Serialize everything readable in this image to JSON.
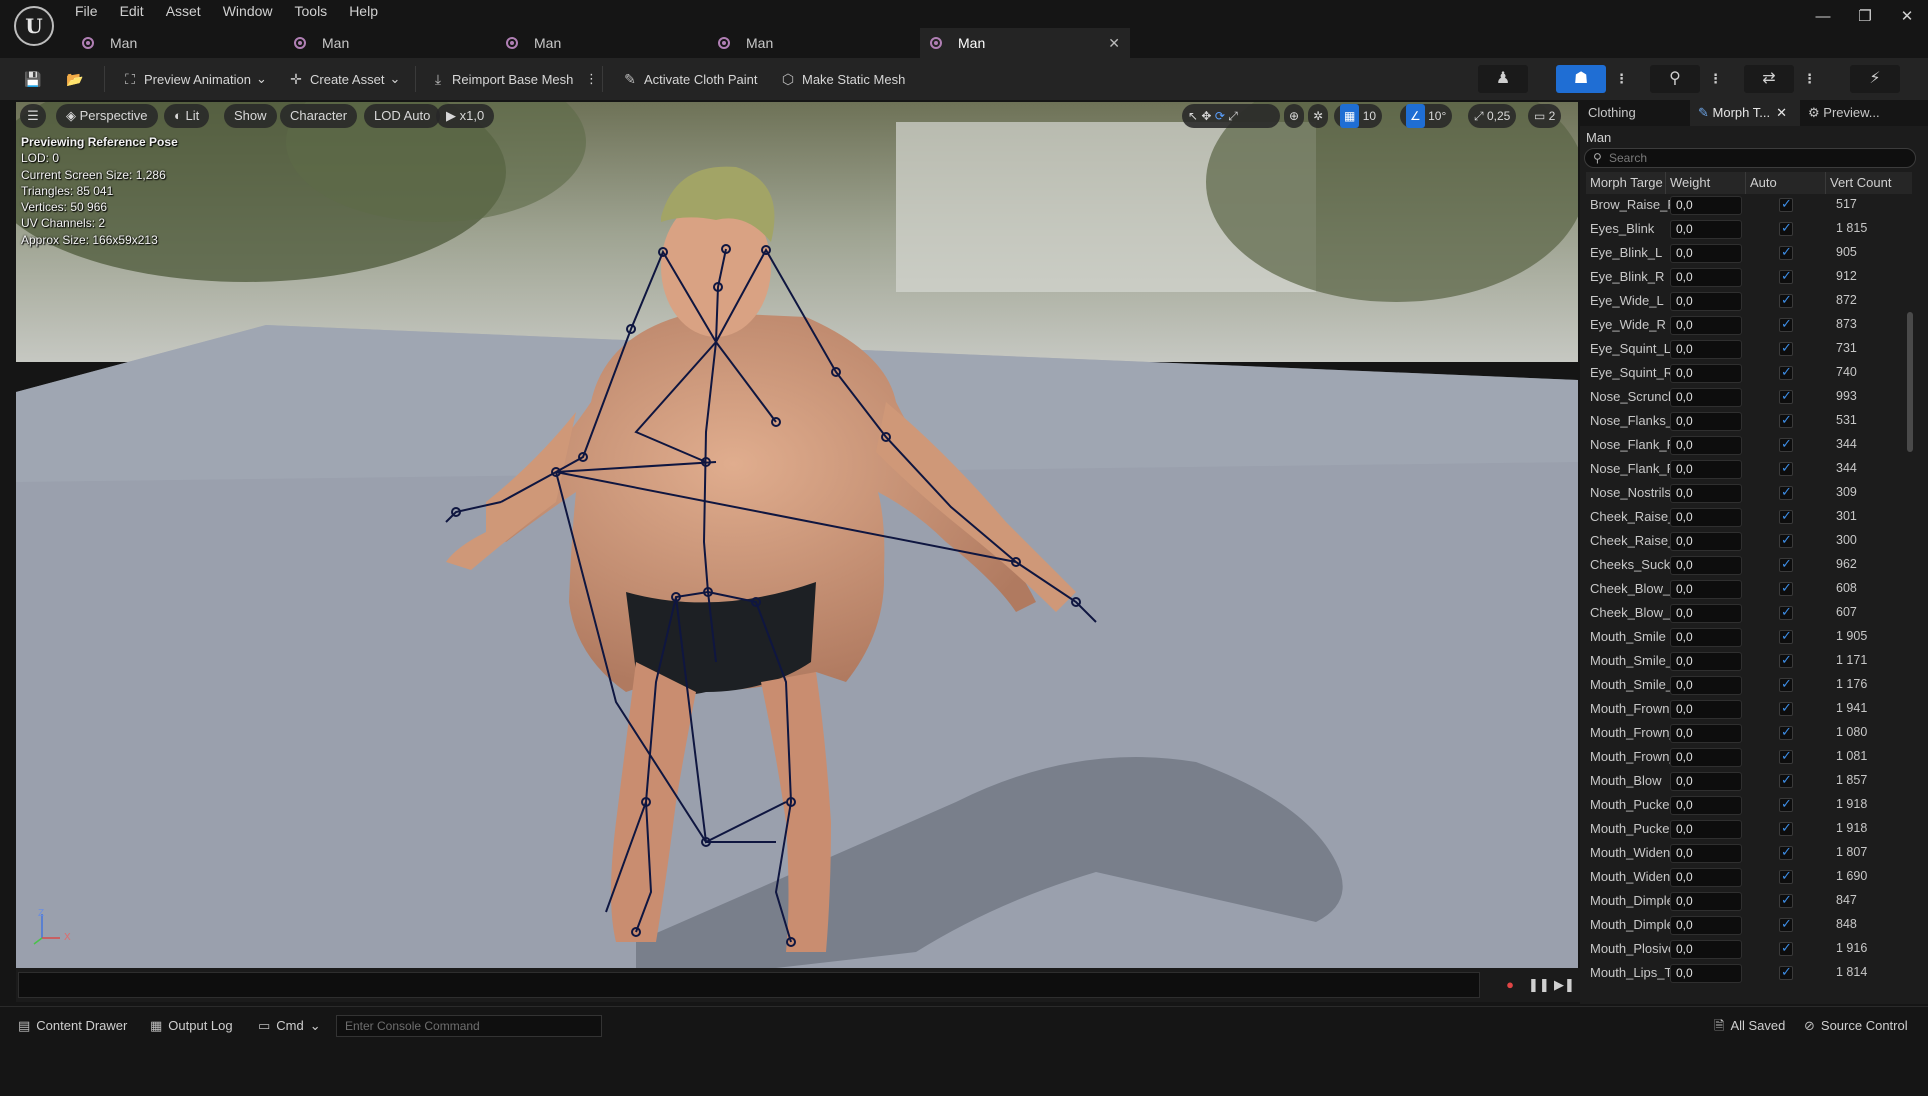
{
  "menu": [
    "File",
    "Edit",
    "Asset",
    "Window",
    "Tools",
    "Help"
  ],
  "doc_tabs": [
    {
      "label": "Man"
    },
    {
      "label": "Man"
    },
    {
      "label": "Man"
    },
    {
      "label": "Man"
    },
    {
      "label": "Man",
      "active": true
    }
  ],
  "window_controls": {
    "minimize": "—",
    "restore": "❐",
    "close": "✕"
  },
  "toolbar": {
    "preview_animation": "Preview Animation",
    "create_asset": "Create Asset",
    "reimport": "Reimport Base Mesh",
    "activate_cloth": "Activate Cloth Paint",
    "make_static": "Make Static Mesh"
  },
  "viewport": {
    "perspective": "Perspective",
    "lit": "Lit",
    "show": "Show",
    "character": "Character",
    "lod": "LOD Auto",
    "speed": "x1,0",
    "grid_snap": "10",
    "rot_snap": "10°",
    "scale_snap": "0,25",
    "camera_speed": "2",
    "info": [
      "Previewing Reference Pose",
      "LOD: 0",
      "Current Screen Size: 1,286",
      "Triangles: 85 041",
      "Vertices: 50 966",
      "UV Channels: 2",
      "Approx Size: 166x59x213"
    ],
    "axis_z": "Z",
    "axis_x": "X"
  },
  "right_panel": {
    "tabs": [
      "Clothing",
      "Morph T...",
      "Preview..."
    ],
    "title": "Man",
    "search_placeholder": "Search",
    "headers": [
      "Morph Targe",
      "Weight",
      "Auto",
      "Vert Count"
    ],
    "rows": [
      {
        "name": "Brow_Raise_F",
        "weight": "0,0",
        "verts": "517"
      },
      {
        "name": "Eyes_Blink",
        "weight": "0,0",
        "verts": "1 815"
      },
      {
        "name": "Eye_Blink_L",
        "weight": "0,0",
        "verts": "905"
      },
      {
        "name": "Eye_Blink_R",
        "weight": "0,0",
        "verts": "912"
      },
      {
        "name": "Eye_Wide_L",
        "weight": "0,0",
        "verts": "872"
      },
      {
        "name": "Eye_Wide_R",
        "weight": "0,0",
        "verts": "873"
      },
      {
        "name": "Eye_Squint_L",
        "weight": "0,0",
        "verts": "731"
      },
      {
        "name": "Eye_Squint_R",
        "weight": "0,0",
        "verts": "740"
      },
      {
        "name": "Nose_Scruncl",
        "weight": "0,0",
        "verts": "993"
      },
      {
        "name": "Nose_Flanks_",
        "weight": "0,0",
        "verts": "531"
      },
      {
        "name": "Nose_Flank_R",
        "weight": "0,0",
        "verts": "344"
      },
      {
        "name": "Nose_Flank_R",
        "weight": "0,0",
        "verts": "344"
      },
      {
        "name": "Nose_Nostrils",
        "weight": "0,0",
        "verts": "309"
      },
      {
        "name": "Cheek_Raise_",
        "weight": "0,0",
        "verts": "301"
      },
      {
        "name": "Cheek_Raise_",
        "weight": "0,0",
        "verts": "300"
      },
      {
        "name": "Cheeks_Suck",
        "weight": "0,0",
        "verts": "962"
      },
      {
        "name": "Cheek_Blow_L",
        "weight": "0,0",
        "verts": "608"
      },
      {
        "name": "Cheek_Blow_F",
        "weight": "0,0",
        "verts": "607"
      },
      {
        "name": "Mouth_Smile",
        "weight": "0,0",
        "verts": "1 905"
      },
      {
        "name": "Mouth_Smile_",
        "weight": "0,0",
        "verts": "1 171"
      },
      {
        "name": "Mouth_Smile_",
        "weight": "0,0",
        "verts": "1 176"
      },
      {
        "name": "Mouth_Frown",
        "weight": "0,0",
        "verts": "1 941"
      },
      {
        "name": "Mouth_Frown_",
        "weight": "0,0",
        "verts": "1 080"
      },
      {
        "name": "Mouth_Frown_",
        "weight": "0,0",
        "verts": "1 081"
      },
      {
        "name": "Mouth_Blow",
        "weight": "0,0",
        "verts": "1 857"
      },
      {
        "name": "Mouth_Pucker",
        "weight": "0,0",
        "verts": "1 918"
      },
      {
        "name": "Mouth_Pucker",
        "weight": "0,0",
        "verts": "1 918"
      },
      {
        "name": "Mouth_Widen",
        "weight": "0,0",
        "verts": "1 807"
      },
      {
        "name": "Mouth_Widen_",
        "weight": "0,0",
        "verts": "1 690"
      },
      {
        "name": "Mouth_Dimple",
        "weight": "0,0",
        "verts": "847"
      },
      {
        "name": "Mouth_Dimple",
        "weight": "0,0",
        "verts": "848"
      },
      {
        "name": "Mouth_Plosive",
        "weight": "0,0",
        "verts": "1 916"
      },
      {
        "name": "Mouth_Lips_T",
        "weight": "0,0",
        "verts": "1 814"
      }
    ]
  },
  "statusbar": {
    "content_drawer": "Content Drawer",
    "output_log": "Output Log",
    "cmd": "Cmd",
    "console_placeholder": "Enter Console Command",
    "all_saved": "All Saved",
    "source_control": "Source Control"
  },
  "colors": {
    "accent": "#1f6ed4",
    "checkbox": "#3d8de5",
    "tab_icon": "#b07fb4"
  }
}
